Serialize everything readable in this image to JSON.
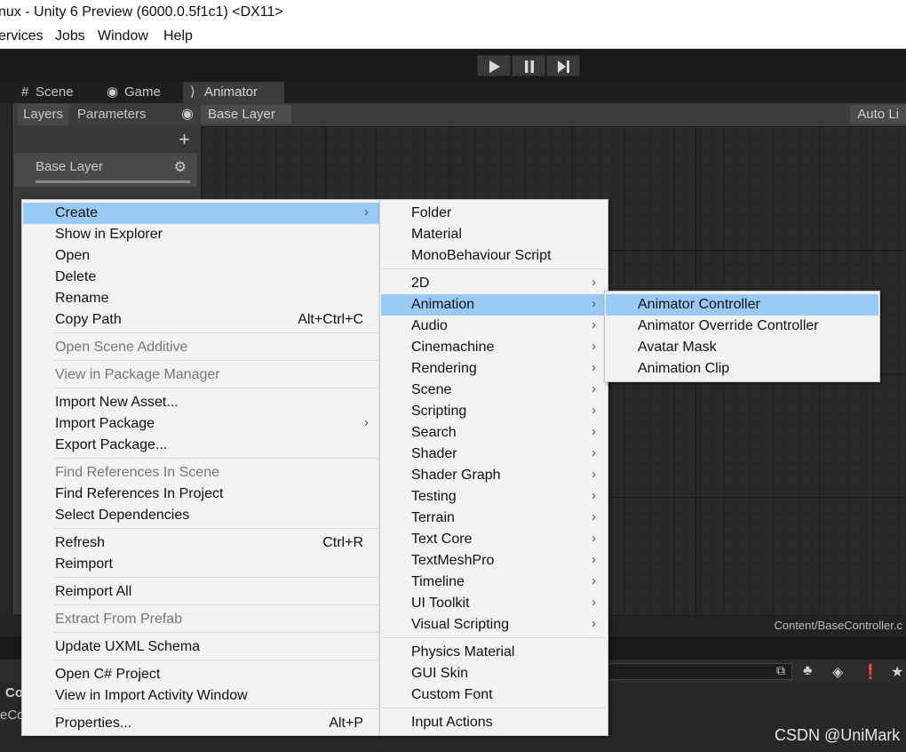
{
  "window": {
    "title": "nux - Unity 6 Preview (6000.0.5f1c1) <DX11>"
  },
  "menubar": {
    "items": [
      "ervices",
      "Jobs",
      "Window",
      "Help"
    ]
  },
  "tabs": [
    {
      "label": "Scene",
      "icon": "grid-icon"
    },
    {
      "label": "Game",
      "icon": "gamepad-icon"
    },
    {
      "label": "Animator",
      "icon": "animator-icon"
    }
  ],
  "animator": {
    "subtabs": [
      "Layers",
      "Parameters"
    ],
    "breadcrumb": "Base Layer",
    "auto_live": "Auto Li",
    "layer_name": "Base Layer",
    "path": "Content/BaseController.c"
  },
  "bottom": {
    "label1": "Co",
    "label2": "eCo"
  },
  "watermark": "CSDN @UniMark",
  "context_menu": {
    "items": [
      {
        "label": "Create",
        "submenu": true,
        "highlighted": true
      },
      {
        "label": "Show in Explorer"
      },
      {
        "label": "Open"
      },
      {
        "label": "Delete"
      },
      {
        "label": "Rename"
      },
      {
        "label": "Copy Path",
        "shortcut": "Alt+Ctrl+C"
      },
      {
        "label": "Open Scene Additive",
        "disabled": true
      },
      {
        "label": "View in Package Manager",
        "disabled": true
      },
      {
        "label": "Import New Asset..."
      },
      {
        "label": "Import Package",
        "submenu": true
      },
      {
        "label": "Export Package..."
      },
      {
        "label": "Find References In Scene",
        "disabled": true
      },
      {
        "label": "Find References In Project"
      },
      {
        "label": "Select Dependencies"
      },
      {
        "label": "Refresh",
        "shortcut": "Ctrl+R"
      },
      {
        "label": "Reimport"
      },
      {
        "label": "Reimport All"
      },
      {
        "label": "Extract From Prefab",
        "disabled": true
      },
      {
        "label": "Update UXML Schema"
      },
      {
        "label": "Open C# Project"
      },
      {
        "label": "View in Import Activity Window"
      },
      {
        "label": "Properties...",
        "shortcut": "Alt+P"
      }
    ]
  },
  "create_menu": {
    "items": [
      {
        "label": "Folder"
      },
      {
        "label": "Material"
      },
      {
        "label": "MonoBehaviour Script"
      },
      {
        "label": "2D",
        "submenu": true
      },
      {
        "label": "Animation",
        "submenu": true,
        "highlighted": true
      },
      {
        "label": "Audio",
        "submenu": true
      },
      {
        "label": "Cinemachine",
        "submenu": true
      },
      {
        "label": "Rendering",
        "submenu": true
      },
      {
        "label": "Scene",
        "submenu": true
      },
      {
        "label": "Scripting",
        "submenu": true
      },
      {
        "label": "Search",
        "submenu": true
      },
      {
        "label": "Shader",
        "submenu": true
      },
      {
        "label": "Shader Graph",
        "submenu": true
      },
      {
        "label": "Testing",
        "submenu": true
      },
      {
        "label": "Terrain",
        "submenu": true
      },
      {
        "label": "Text Core",
        "submenu": true
      },
      {
        "label": "TextMeshPro",
        "submenu": true
      },
      {
        "label": "Timeline",
        "submenu": true
      },
      {
        "label": "UI Toolkit",
        "submenu": true
      },
      {
        "label": "Visual Scripting",
        "submenu": true
      },
      {
        "label": "Physics Material"
      },
      {
        "label": "GUI Skin"
      },
      {
        "label": "Custom Font"
      },
      {
        "label": "Input Actions"
      }
    ]
  },
  "animation_menu": {
    "items": [
      {
        "label": "Animator Controller",
        "highlighted": true
      },
      {
        "label": "Animator Override Controller"
      },
      {
        "label": "Avatar Mask"
      },
      {
        "label": "Animation Clip"
      }
    ]
  },
  "colors": {
    "highlight": "#99c9f5",
    "menu_bg": "#f2f2f2",
    "editor_bg": "#2a2a2a"
  },
  "icons": [
    "play-icon",
    "pause-icon",
    "step-icon",
    "plus-icon",
    "gear-icon",
    "eye-icon",
    "chevron-right-icon"
  ]
}
